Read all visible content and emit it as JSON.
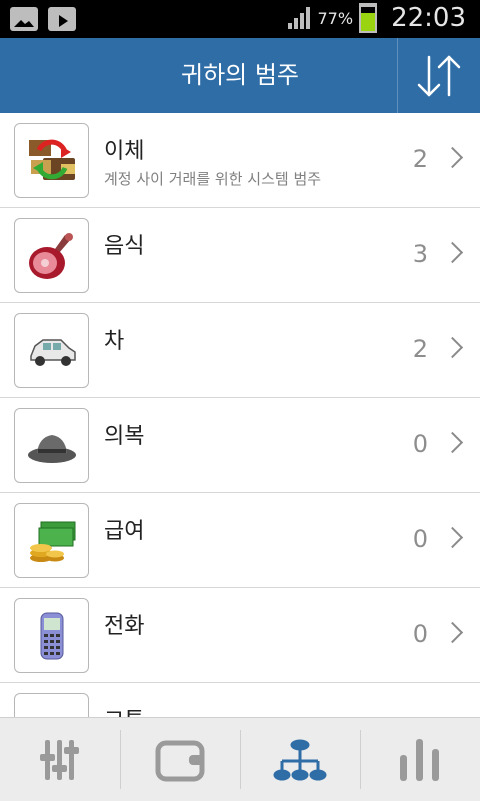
{
  "status_bar": {
    "battery_percent": "77%",
    "time": "22:03"
  },
  "header": {
    "title": "귀하의 범주",
    "sort_icon": "sort-up-down-icon"
  },
  "categories": [
    {
      "name": "이체",
      "description": "계정 사이 거래를 위한 시스템 범주",
      "count": "2",
      "icon": "transfer-icon"
    },
    {
      "name": "음식",
      "description": "",
      "count": "3",
      "icon": "ham-icon"
    },
    {
      "name": "차",
      "description": "",
      "count": "2",
      "icon": "car-icon"
    },
    {
      "name": "의복",
      "description": "",
      "count": "0",
      "icon": "hat-icon"
    },
    {
      "name": "급여",
      "description": "",
      "count": "0",
      "icon": "money-icon"
    },
    {
      "name": "전화",
      "description": "",
      "count": "0",
      "icon": "phone-icon"
    },
    {
      "name": "교통",
      "description": "",
      "count": "",
      "icon": "transport-icon"
    }
  ],
  "bottom_nav": [
    {
      "icon": "sliders-icon",
      "active": false
    },
    {
      "icon": "wallet-icon",
      "active": false
    },
    {
      "icon": "hierarchy-icon",
      "active": true
    },
    {
      "icon": "bar-chart-icon",
      "active": false
    }
  ],
  "colors": {
    "header_bg": "#2f6da7",
    "active_tab": "#2f6da7",
    "inactive_tab": "#9a9a9a"
  }
}
